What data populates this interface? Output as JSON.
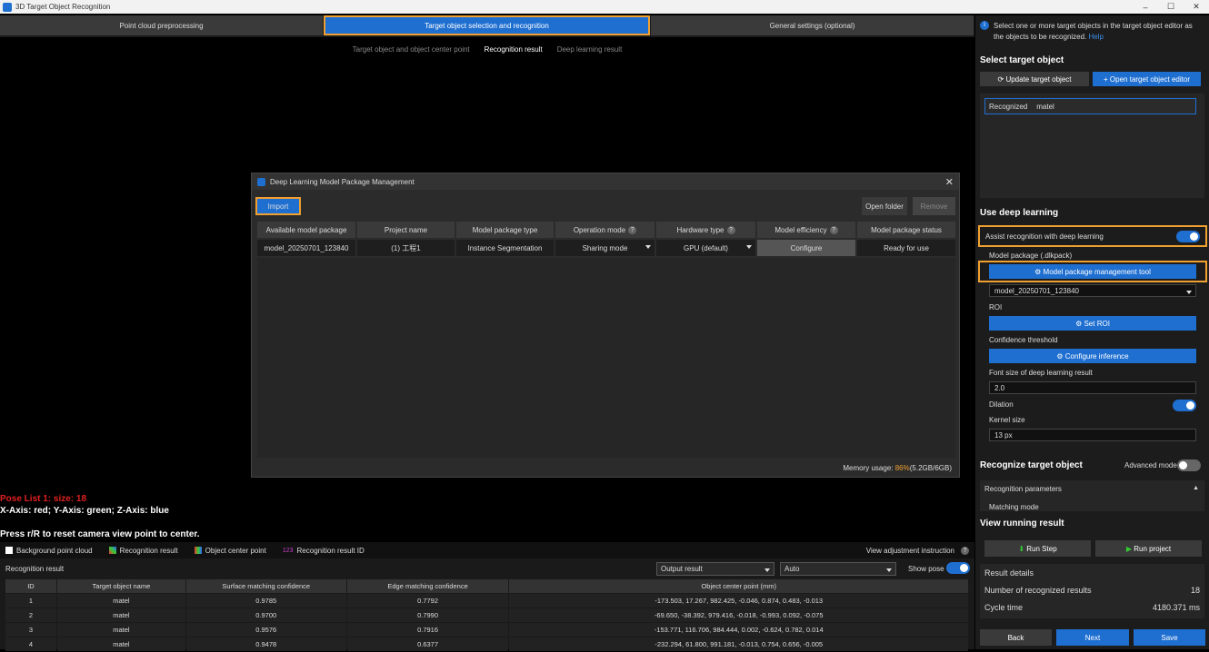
{
  "window": {
    "title": "3D Target Object Recognition"
  },
  "steps": [
    "Point cloud preprocessing",
    "Target object selection and recognition",
    "General settings (optional)"
  ],
  "subtabs": [
    "Target object and object center point",
    "Recognition result",
    "Deep learning result"
  ],
  "viewport": {
    "pose_list": "Pose List 1: size: 18",
    "axes": "X-Axis: red; Y-Axis: green; Z-Axis: blue",
    "reset_hint": "Press r/R to reset camera view point to center."
  },
  "dialog": {
    "title": "Deep Learning Model Package Management",
    "import": "Import",
    "open_folder": "Open folder",
    "remove": "Remove",
    "headers": [
      "Available model package",
      "Project name",
      "Model package type",
      "Operation mode",
      "Hardware type",
      "Model efficiency",
      "Model package status"
    ],
    "row": [
      "model_20250701_123840",
      "(1) 工程1",
      "Instance Segmentation",
      "Sharing mode",
      "GPU (default)",
      "Configure",
      "Ready for use"
    ],
    "memory_label": "Memory usage:",
    "memory_pct": "86%",
    "memory_detail": "(5.2GB/6GB)"
  },
  "legend": {
    "bg": "Background point cloud",
    "rr": "Recognition result",
    "ocp": "Object center point",
    "rrid": "Recognition result ID",
    "rrid_icon": "123",
    "hint": "View adjustment instruction"
  },
  "results": {
    "label": "Recognition result",
    "output": "Output result",
    "auto": "Auto",
    "show_pose": "Show pose",
    "headers": [
      "ID",
      "Target object name",
      "Surface matching confidence",
      "Edge matching confidence",
      "Object center point (mm)"
    ],
    "rows": [
      [
        "1",
        "matel",
        "0.9785",
        "0.7792",
        "-173.503, 17.267, 982.425, -0.046, 0.874, 0.483, -0.013"
      ],
      [
        "2",
        "matel",
        "0.9700",
        "0.7990",
        "-69.650, -38.392, 979.416, -0.018, -0.993, 0.092, -0.075"
      ],
      [
        "3",
        "matel",
        "0.9576",
        "0.7916",
        "-153.771, 116.706, 984.444, 0.002, -0.624, 0.782, 0.014"
      ],
      [
        "4",
        "matel",
        "0.9478",
        "0.6377",
        "-232.294, 61.800, 991.181, -0.013, 0.754, 0.656, -0.005"
      ]
    ]
  },
  "right": {
    "info": "Select one or more target objects in the target object editor as the objects to be recognized.",
    "help": "Help",
    "select_title": "Select target object",
    "update": "Update target object",
    "open_editor": "Open target object editor",
    "recognized": "Recognized",
    "obj": "matel",
    "dl_title": "Use deep learning",
    "assist": "Assist recognition with deep learning",
    "pkg_label": "Model package (.dlkpack)",
    "pkg_tool": "Model package management tool",
    "pkg_value": "model_20250701_123840",
    "roi": "ROI",
    "set_roi": "Set ROI",
    "conf": "Confidence threshold",
    "conf_btn": "Configure inference",
    "font_label": "Font size of deep learning result",
    "font_val": "2.0",
    "dilation": "Dilation",
    "kernel": "Kernel size",
    "kernel_val": "13 px",
    "rec_title": "Recognize target object",
    "advanced": "Advanced mode",
    "rec_params": "Recognition parameters",
    "matching": "Matching mode",
    "view_title": "View running result",
    "run_step": "Run Step",
    "run_project": "Run project",
    "details": "Result details",
    "num_label": "Number of recognized results",
    "num_val": "18",
    "cycle_label": "Cycle time",
    "cycle_val": "4180.371 ms",
    "back": "Back",
    "next": "Next",
    "save": "Save"
  }
}
